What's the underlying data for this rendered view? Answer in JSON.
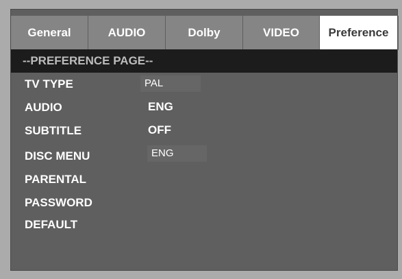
{
  "tabs": [
    {
      "label": "General"
    },
    {
      "label": "AUDIO"
    },
    {
      "label": "Dolby"
    },
    {
      "label": "VIDEO"
    },
    {
      "label": "Preference",
      "active": true
    }
  ],
  "page_header": "--PREFERENCE PAGE--",
  "settings": [
    {
      "label": "TV TYPE",
      "value": "PAL"
    },
    {
      "label": "AUDIO",
      "value": "ENG"
    },
    {
      "label": "SUBTITLE",
      "value": "OFF"
    },
    {
      "label": "DISC MENU",
      "value": "ENG"
    },
    {
      "label": "PARENTAL",
      "value": ""
    },
    {
      "label": "PASSWORD",
      "value": ""
    },
    {
      "label": "DEFAULT",
      "value": ""
    }
  ],
  "colors": {
    "background": "#ababab",
    "screen": "#5f5f5f",
    "tab": "#858585",
    "active_tab": "#ffffff",
    "header_bar": "#1c1c1c",
    "header_text": "#bdbdbd"
  }
}
